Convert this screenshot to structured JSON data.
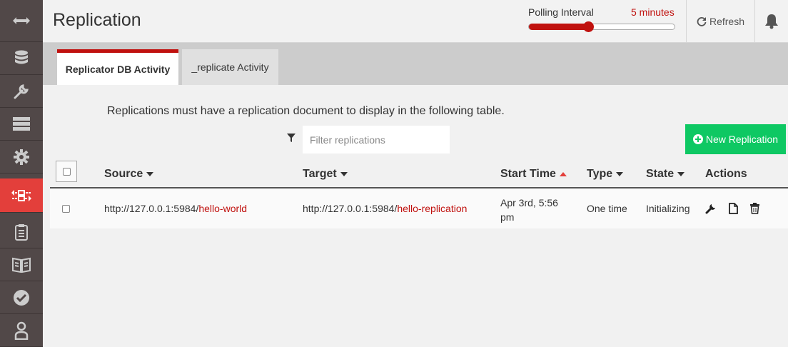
{
  "sidebar": {
    "items": [
      {
        "icon": "arrows-horizontal-icon"
      },
      {
        "icon": "database-icon"
      },
      {
        "icon": "wrench-icon"
      },
      {
        "icon": "server-icon"
      },
      {
        "icon": "gear-icon"
      },
      {
        "icon": "replication-icon",
        "active": true
      },
      {
        "icon": "clipboard-icon"
      },
      {
        "icon": "book-icon"
      },
      {
        "icon": "checkmark-icon"
      },
      {
        "icon": "user-icon"
      }
    ]
  },
  "header": {
    "title": "Replication",
    "polling_label": "Polling Interval",
    "polling_value": "5 minutes",
    "polling_fraction": 0.4,
    "refresh_label": "Refresh"
  },
  "tabs": [
    {
      "label": "Replicator DB Activity",
      "active": true
    },
    {
      "label": "_replicate Activity",
      "active": false
    }
  ],
  "main": {
    "info_text": "Replications must have a replication document to display in the following table.",
    "filter_placeholder": "Filter replications",
    "new_button_label": "New Replication"
  },
  "table": {
    "columns": [
      "Source",
      "Target",
      "Start Time",
      "Type",
      "State",
      "Actions"
    ],
    "rows": [
      {
        "source_host": "http://127.0.0.1:5984/",
        "source_db": "hello-world",
        "target_host": "http://127.0.0.1:5984/",
        "target_db": "hello-replication",
        "start_time_line1": "Apr 3rd, 5:56",
        "start_time_line2": "pm",
        "type": "One time",
        "state": "Initializing"
      }
    ]
  },
  "colors": {
    "accent": "#c0110e",
    "sidebar_bg": "#514848",
    "sidebar_active": "#e33f3b",
    "new_button": "#0ec863"
  }
}
